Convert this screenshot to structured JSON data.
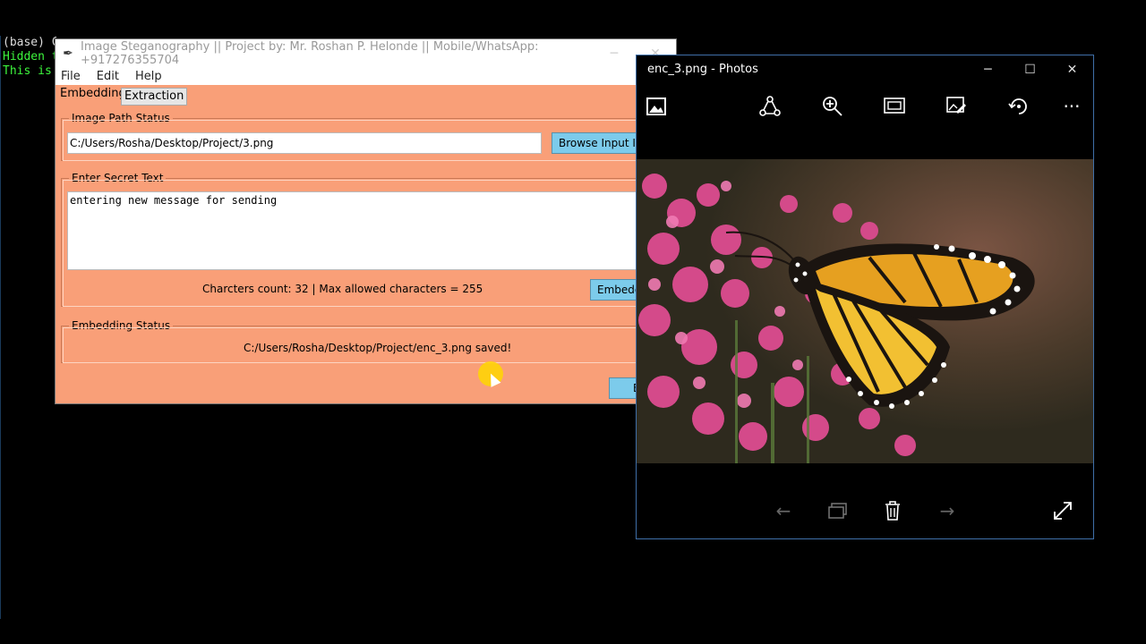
{
  "terminal": {
    "lines": [
      "(base) C",
      "Hidden t",
      "This is "
    ]
  },
  "steg": {
    "title": "Image Steganography || Project by: Mr. Roshan P. Helonde || Mobile/WhatsApp: +917276355704",
    "menu": [
      "File",
      "Edit",
      "Help"
    ],
    "tabs": [
      "Embedding",
      "Extraction"
    ],
    "image_path_label": "Image Path Status",
    "image_path_value": "C:/Users/Rosha/Desktop/Project/3.png",
    "browse_button": "Browse Input Im",
    "secret_label": "Enter Secret Text",
    "secret_value": "entering new message for sending",
    "count_text": "Charcters count: 32 | Max allowed characters = 255",
    "embed_button": "Embedd",
    "status_label": "Embedding Status",
    "status_value": "C:/Users/Rosha/Desktop/Project/enc_3.png saved!",
    "exit_button": "E"
  },
  "photos": {
    "title": "enc_3.png - Photos",
    "window_controls": [
      "minimize-icon",
      "maximize-icon",
      "close-icon"
    ],
    "toolbar_icons": [
      "gallery-icon",
      "share-icon",
      "zoom-in-icon",
      "slideshow-icon",
      "edit-icon",
      "rotate-icon",
      "more-icon"
    ],
    "bottom_icons": [
      "previous-icon",
      "filmstrip-icon",
      "delete-icon",
      "next-icon",
      "fullscreen-icon"
    ]
  }
}
